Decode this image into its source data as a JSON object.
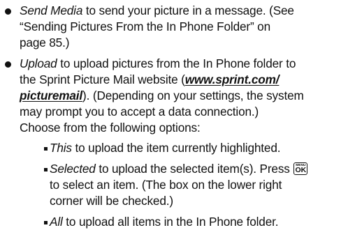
{
  "items": [
    {
      "term": "Send Media",
      "text": " to send your picture in a message. (See",
      "line2": "“Sending Pictures From the In Phone Folder” on",
      "line3": "page 85.)"
    },
    {
      "term": "Upload",
      "text": " to upload pictures from the In Phone folder to",
      "line2": "the Sprint Picture Mail website (",
      "link_part1": "www.sprint.com/",
      "link_part2": "picturemail",
      "line3_after": "). (Depending on your settings, the system",
      "line4": "may prompt you to accept a data connection.)",
      "line5": "Choose from the following options:",
      "options": [
        {
          "term": "This",
          "text": " to upload the item currently highlighted."
        },
        {
          "term": "Selected",
          "text": " to upload the selected item(s). Press ",
          "key_top": "MENU",
          "key_bottom": "OK",
          "line2": "to select an item. (The box on the lower right",
          "line3": "corner will be checked.)"
        },
        {
          "term": "All",
          "text": " to upload all items in the In Phone folder."
        }
      ]
    }
  ]
}
